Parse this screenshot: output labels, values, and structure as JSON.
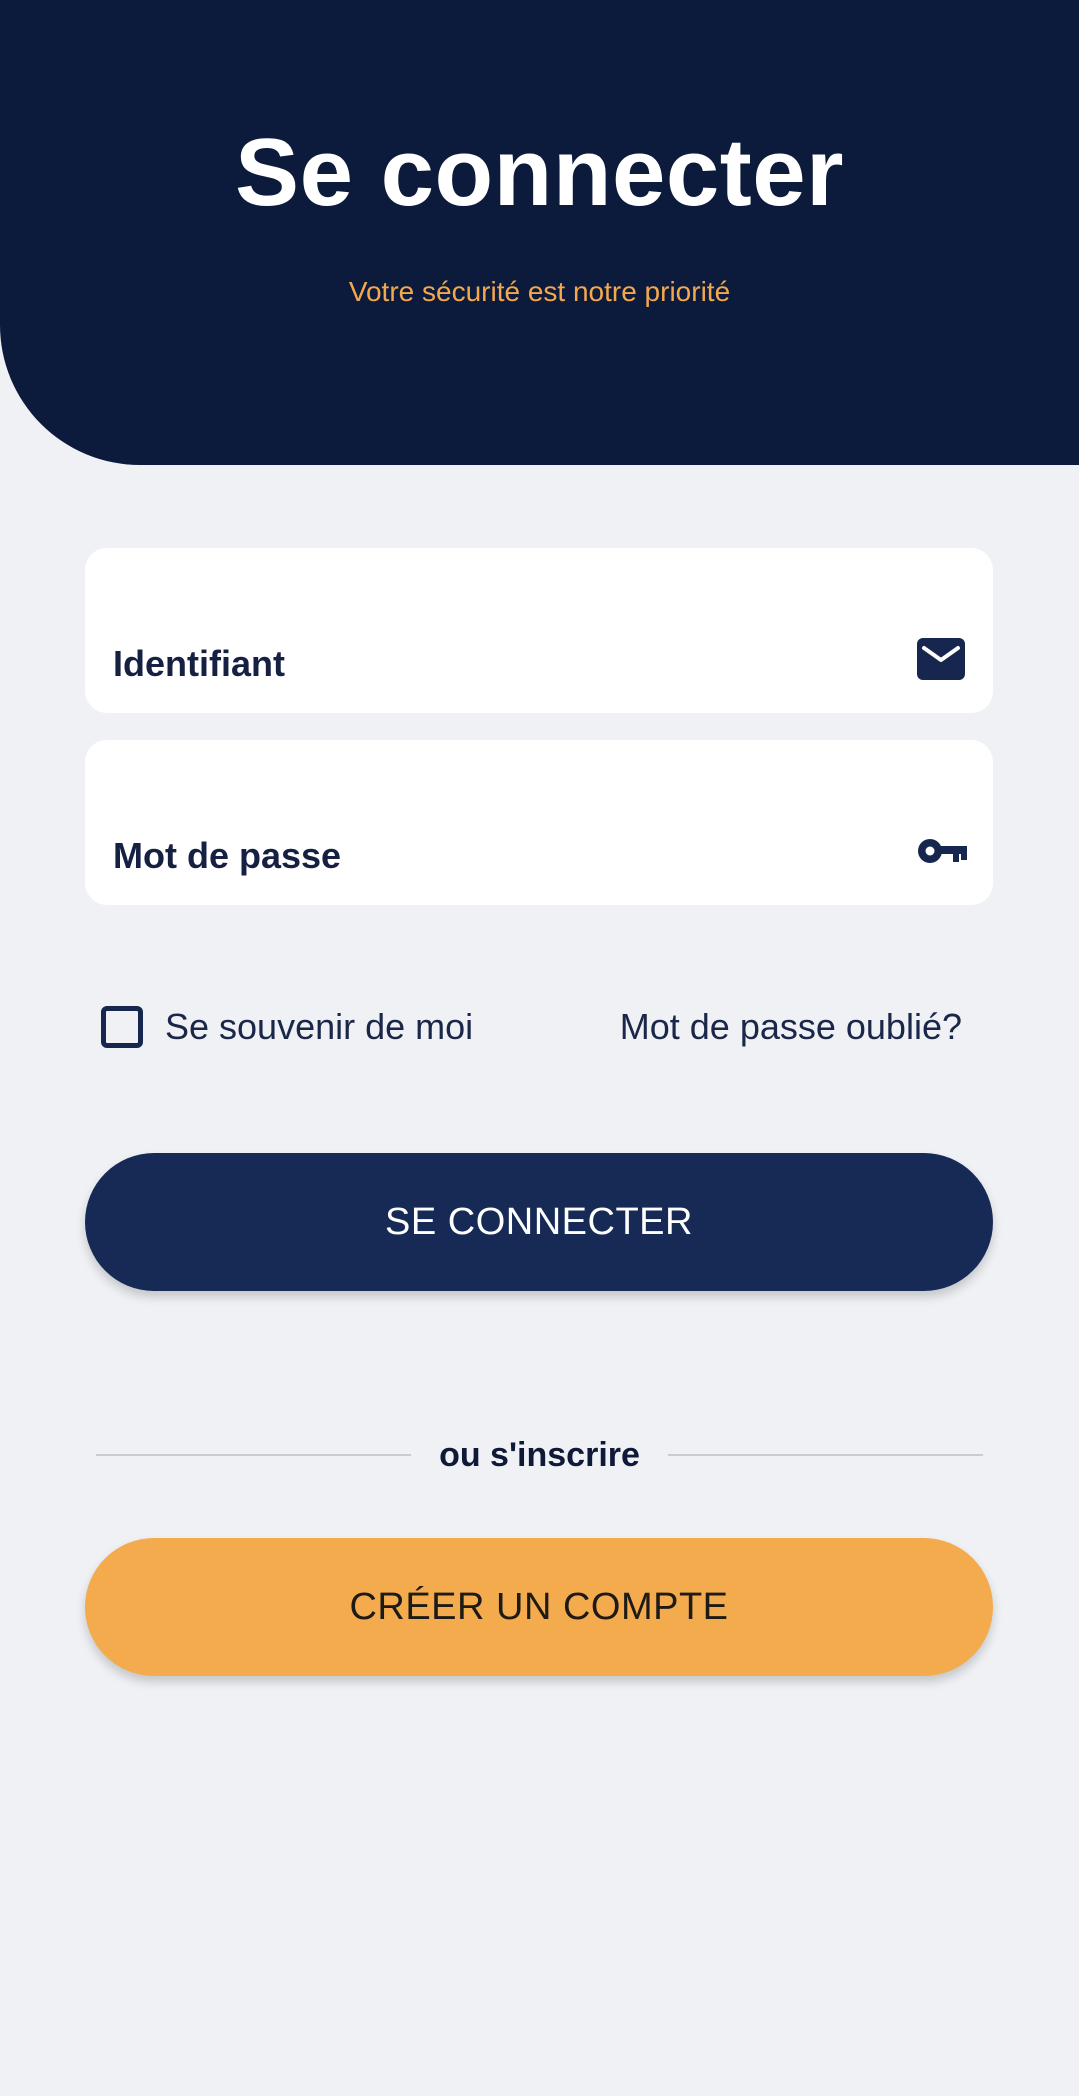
{
  "header": {
    "title": "Se connecter",
    "subtitle": "Votre sécurité est notre priorité"
  },
  "form": {
    "username_label": "Identifiant",
    "username_icon": "mail-icon",
    "password_label": "Mot de passe",
    "password_icon": "key-icon",
    "remember_label": "Se souvenir de moi",
    "remember_checked": false,
    "forgot_label": "Mot de passe oublié?"
  },
  "actions": {
    "login_label": "SE CONNECTER",
    "divider_label": "ou s'inscrire",
    "create_label": "CRÉER UN COMPTE"
  },
  "colors": {
    "header_bg": "#0c1a3c",
    "accent": "#f3a84d",
    "primary_button": "#162a55",
    "page_bg": "#eff1f5"
  }
}
